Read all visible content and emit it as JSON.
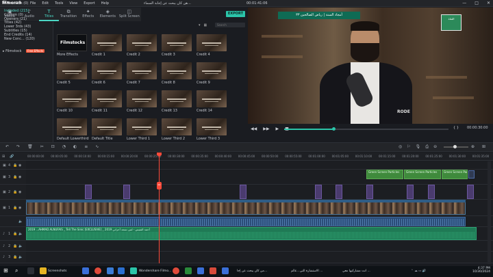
{
  "app": {
    "logo": "filmora9",
    "document_title": "هن كان يبحث عن إجابة السماء...",
    "timecode_top": "00:01:41:06"
  },
  "menu": [
    "File",
    "Edit",
    "Tools",
    "View",
    "Export",
    "Help"
  ],
  "tabs": [
    {
      "label": "Media",
      "icon": "▣"
    },
    {
      "label": "Audio",
      "icon": "♪"
    },
    {
      "label": "Titles",
      "icon": "T"
    },
    {
      "label": "Transition",
      "icon": "⧉"
    },
    {
      "label": "Effects",
      "icon": "✦"
    },
    {
      "label": "Elements",
      "icon": "◈"
    },
    {
      "label": "Split Screen",
      "icon": "◫"
    }
  ],
  "export_label": "EXPORT",
  "sidebar": {
    "favorites": "♥ Favorites (0)",
    "items": [
      "Included (215)",
      "Custom (0)",
      "Openers (21)",
      "Titles (42)",
      "Lower 3rds (43)",
      "Subtitles (15)",
      "End Credits (14)",
      "New Conc... (120)"
    ],
    "filmstock": "Filmstock",
    "filmstock_badge": "Free Effects"
  },
  "search_placeholder": "Search",
  "thumbnails": [
    "More Effects",
    "Credit 1",
    "Credit 2",
    "Credit 3",
    "Credit 4",
    "Credit 5",
    "Credit 6",
    "Credit 7",
    "Credit 8",
    "Credit 9",
    "Credit 10",
    "Credit 11",
    "Credit 12",
    "Credit 13",
    "Credit 14",
    "Default Lowerthird",
    "Default Title",
    "Lower Third 1",
    "Lower Third 2",
    "Lower Third 3"
  ],
  "filmstocks_text": "Filmstocks",
  "preview": {
    "caption": "أمجاد السنة | رياض الصالحين ٣٣",
    "channel_logo": "القناة",
    "mic_brand": "RODE",
    "timecode": "00:00:30:00",
    "progress": 0.3
  },
  "ruler_ticks": [
    "00:00:00:00",
    "00:00:05:00",
    "00:00:10:00",
    "00:00:15:00",
    "00:00:20:00",
    "00:00:25:00",
    "00:00:30:00",
    "00:00:35:00",
    "00:00:40:00",
    "00:00:45:00",
    "00:00:50:00",
    "00:00:55:00",
    "00:01:00:00",
    "00:01:05:00",
    "00:01:10:00",
    "00:01:15:00",
    "00:01:20:00",
    "00:01:25:00",
    "00:01:30:00",
    "00:01:35:00"
  ],
  "tracks": {
    "t4": "4",
    "t3": "3",
    "t2": "2",
    "t1": "1",
    "a1": "1",
    "a2": "2",
    "a3": "3"
  },
  "green_clips": [
    "Green Screen Particles",
    "Green Screen Particles",
    "Green Screen Par"
  ],
  "music_clip": "2019 ...AHMAD ALNUFAIS _ Tell The Sinic [EXCLUSIVE] _ 2019 أحمد النفيس - لمن تسعد أحزاني",
  "taskbar": {
    "search_icon": "⌕",
    "items": [
      "Screenshots",
      "Wondershare Filmo...",
      "من كان يبحث عن إجا...",
      "الاستشارة التي...عالم ...",
      "انت مشاركيها معي ..."
    ],
    "time": "4:37 PM",
    "date": "10/30/2024"
  }
}
